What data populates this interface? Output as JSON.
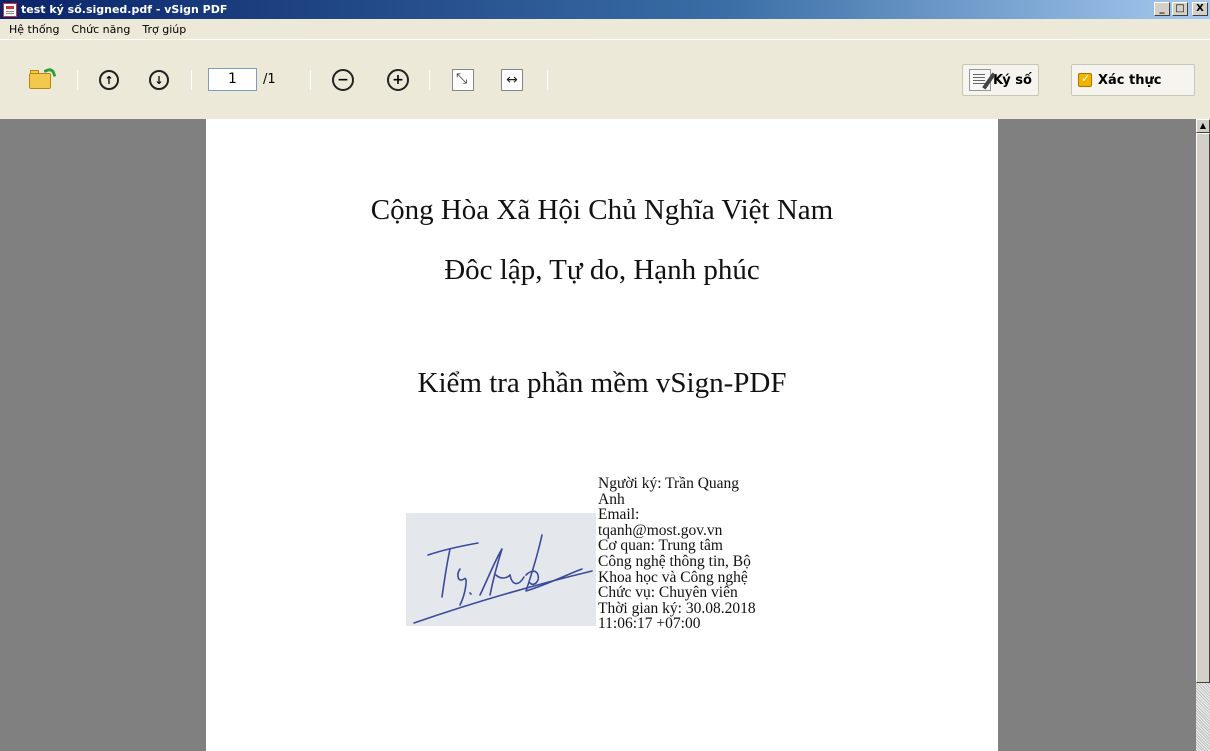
{
  "window": {
    "title": "test ký số.signed.pdf - vSign PDF",
    "minimize": "_",
    "maximize": "□",
    "close": "X"
  },
  "menu": [
    "Hệ thống",
    "Chức năng",
    "Trợ giúp"
  ],
  "toolbar": {
    "page_current": "1",
    "page_total": "/1",
    "sign_label": "Ký số",
    "verify_label": "Xác thực"
  },
  "document": {
    "line1": "Cộng Hòa Xã Hội Chủ Nghĩa Việt Nam",
    "line2": "Đôc lập, Tự do, Hạnh phúc",
    "line3": "Kiểm tra phần mềm vSign-PDF",
    "signature_info": [
      "Người ký: Trần Quang",
      "Anh",
      "Email:",
      "tqanh@most.gov.vn",
      "Cơ quan: Trung tâm",
      "Công nghệ thông tin, Bộ",
      "Khoa học và Công nghệ",
      "Chức vụ: Chuyên viên",
      "Thời gian ký: 30.08.2018",
      "11:06:17 +07:00"
    ]
  },
  "icons": {
    "open": "folder-open-icon",
    "prev": "arrow-up-circle-icon",
    "next": "arrow-down-circle-icon",
    "zoom_out": "zoom-out-icon",
    "zoom_in": "zoom-in-icon",
    "fit_page": "fit-page-icon",
    "fit_width": "fit-width-icon"
  },
  "colors": {
    "titlebar": "#0a246a",
    "viewer_bg": "#808080",
    "signature_stroke": "#3a4a9c"
  }
}
